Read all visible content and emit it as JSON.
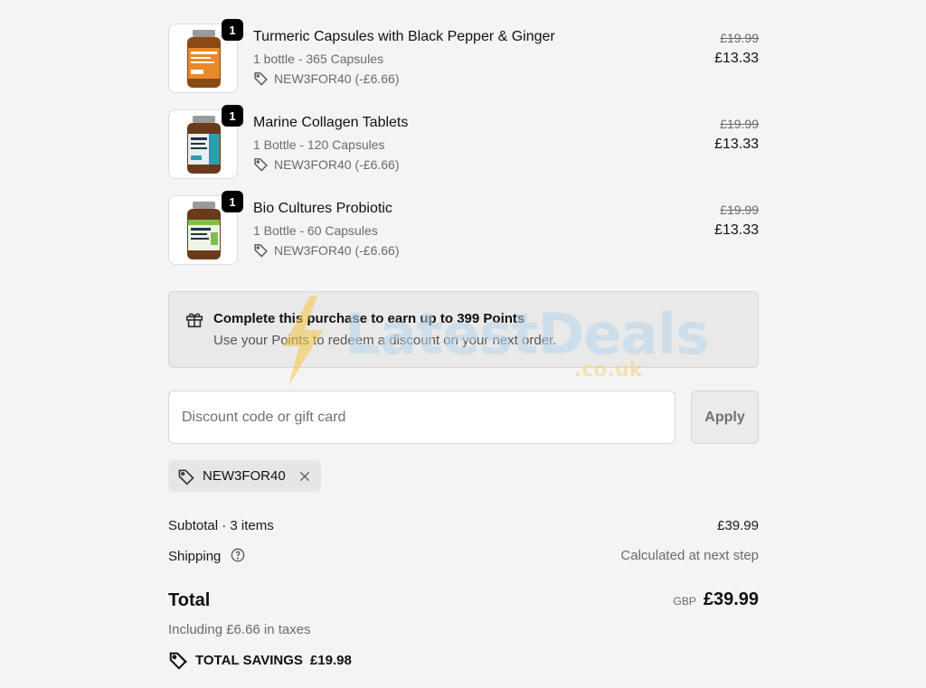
{
  "items": [
    {
      "name": "Turmeric Capsules with Black Pepper & Ginger",
      "variant": "1 bottle - 365 Capsules",
      "discount": "NEW3FOR40 (-£6.66)",
      "old_price": "£19.99",
      "price": "£13.33",
      "quantity": "1",
      "label_color": "#e8892a"
    },
    {
      "name": "Marine Collagen Tablets",
      "variant": "1 Bottle - 120 Capsules",
      "discount": "NEW3FOR40 (-£6.66)",
      "old_price": "£19.99",
      "price": "£13.33",
      "quantity": "1",
      "label_color": "#2a9fb0"
    },
    {
      "name": "Bio Cultures Probiotic",
      "variant": "1 Bottle - 60 Capsules",
      "discount": "NEW3FOR40 (-£6.66)",
      "old_price": "£19.99",
      "price": "£13.33",
      "quantity": "1",
      "label_color": "#7cc04a"
    }
  ],
  "points": {
    "title": "Complete this purchase to earn up to 399 Points",
    "subtitle": "Use your Points to redeem a discount on your next order.",
    "icon": "gift-icon"
  },
  "discount_form": {
    "placeholder": "Discount code or gift card",
    "value": "",
    "apply_label": "Apply"
  },
  "applied_code": {
    "code": "NEW3FOR40",
    "icon": "tag-icon",
    "remove_icon": "close-icon"
  },
  "summary": {
    "subtotal_label": "Subtotal · 3 items",
    "subtotal_value": "£39.99",
    "shipping_label": "Shipping",
    "shipping_value": "Calculated at next step",
    "total_label": "Total",
    "currency": "GBP",
    "total_value": "£39.99",
    "tax_note": "Including £6.66 in taxes",
    "savings_label": "TOTAL SAVINGS",
    "savings_value": "£19.98"
  },
  "watermark": {
    "text": "LatestDeals",
    "sub": ".co.uk"
  },
  "colors": {
    "background": "#f4f4f4",
    "badge": "#000000",
    "brand_lightning": "#f5c542"
  }
}
